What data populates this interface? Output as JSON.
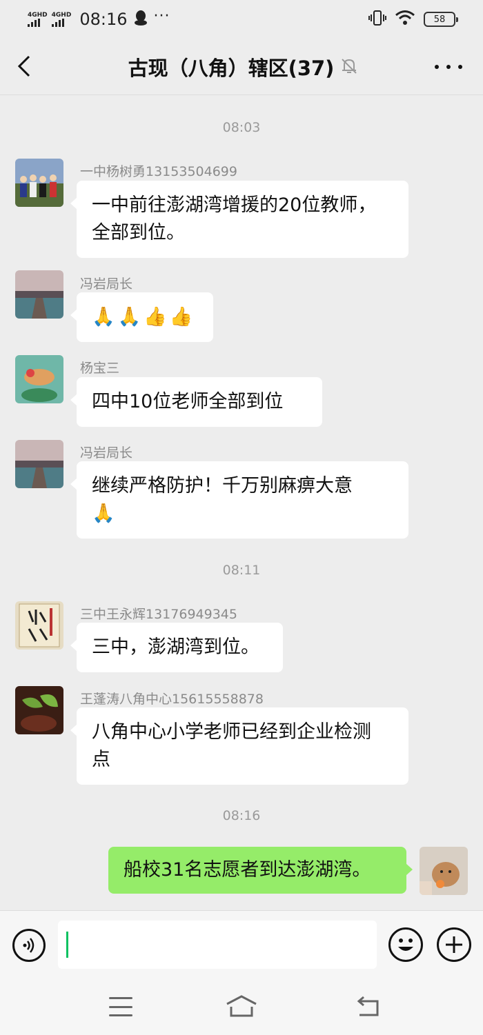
{
  "status_bar": {
    "signal1_label": "4GHD",
    "signal2_label": "4GHD",
    "time": "08:16",
    "more": "···",
    "battery": "58"
  },
  "header": {
    "title": "古现（八角）辖区(37)"
  },
  "messages": [
    {
      "type": "time",
      "text": "08:03"
    },
    {
      "type": "received",
      "sender": "一中杨树勇13153504699",
      "text_line1": "一中前往澎湖湾增援的20位教师，",
      "text_line2": "全部到位。"
    },
    {
      "type": "received",
      "sender": "冯岩局长",
      "emoji": [
        "🙏",
        "🙏",
        "👍",
        "👍"
      ]
    },
    {
      "type": "received",
      "sender": "杨宝三",
      "text_line1": "四中10位老师全部到位"
    },
    {
      "type": "received",
      "sender": "冯岩局长",
      "text_line1": "继续严格防护！千万别麻痹大意",
      "emoji": [
        "🙏"
      ]
    },
    {
      "type": "time",
      "text": "08:11"
    },
    {
      "type": "received",
      "sender": "三中王永辉13176949345",
      "text_line1": "三中，澎湖湾到位。"
    },
    {
      "type": "received",
      "sender": "王蓬涛八角中心15615558878",
      "text_line1": "八角中心小学老师已经到企业检测",
      "text_line2": "点"
    },
    {
      "type": "time",
      "text": "08:16"
    },
    {
      "type": "sent",
      "text_line1": "船校31名志愿者到达澎湖湾。"
    }
  ],
  "input": {
    "value": "",
    "placeholder": ""
  },
  "colors": {
    "background": "#ededed",
    "sent_bubble": "#95ec69",
    "received_bubble": "#ffffff",
    "caret": "#07c160"
  }
}
